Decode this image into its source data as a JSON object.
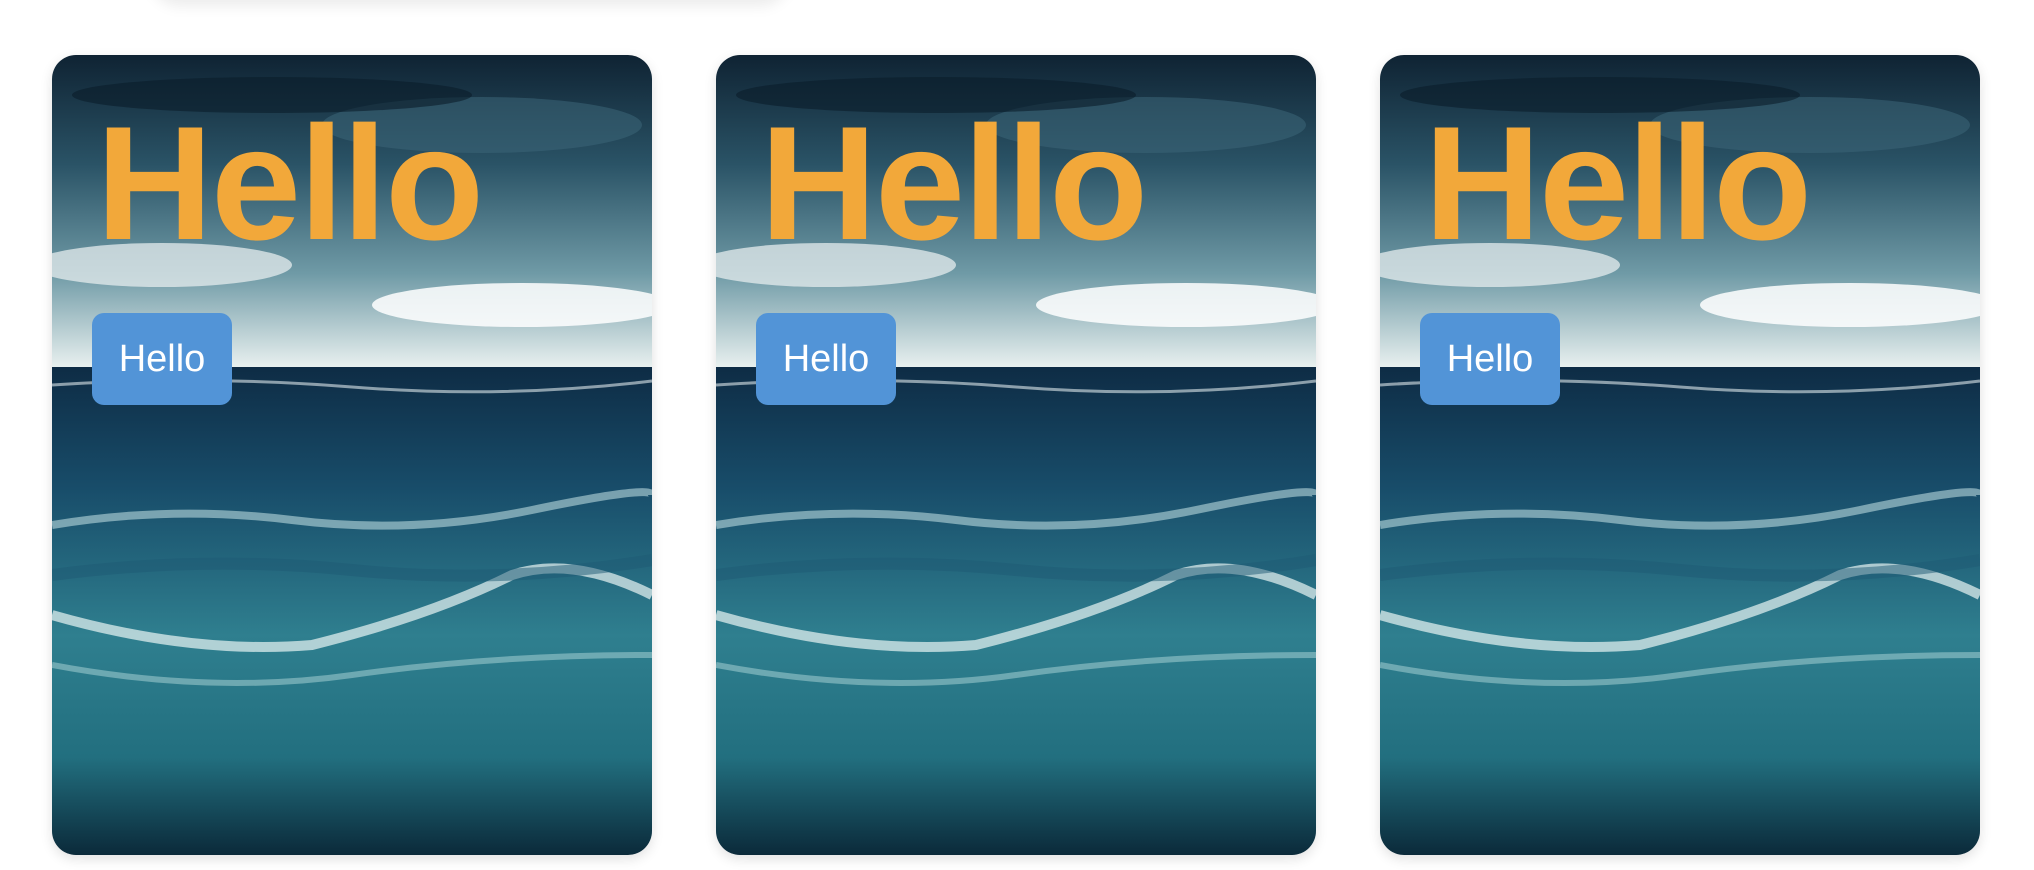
{
  "cards": [
    {
      "title": "Hello",
      "button_label": "Hello"
    },
    {
      "title": "Hello",
      "button_label": "Hello"
    },
    {
      "title": "Hello",
      "button_label": "Hello"
    }
  ],
  "colors": {
    "title": "#f2a83a",
    "button": "#5294d7",
    "button_text": "#ffffff"
  },
  "background_image": "stormy-ocean-waves"
}
